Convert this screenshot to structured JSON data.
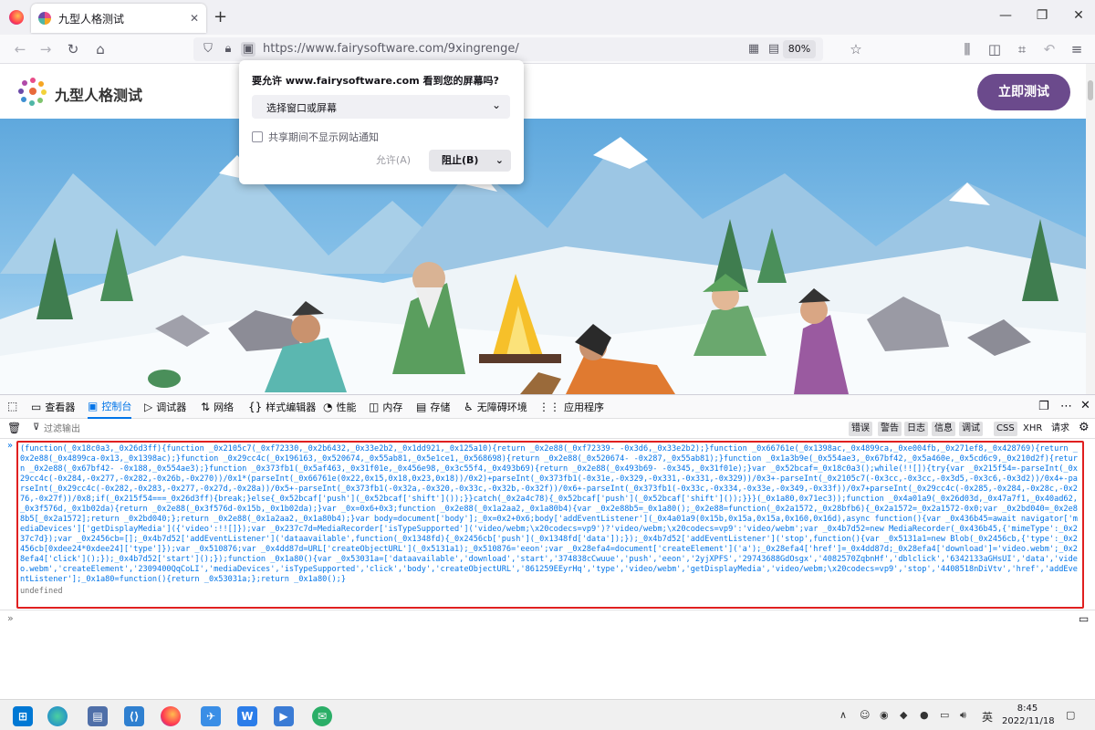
{
  "browser": {
    "tab_title": "九型人格测试",
    "url": "https://www.fairysoftware.com/9xingrenge/",
    "zoom": "80%"
  },
  "site": {
    "name": "九型人格测试",
    "cta": "立即测试"
  },
  "permission": {
    "question": "要允许 www.fairysoftware.com 看到您的屏幕吗?",
    "select_value": "选择窗口或屏幕",
    "checkbox_label": "共享期间不显示网站通知",
    "allow": "允许(A)",
    "deny": "阻止(B)"
  },
  "devtools": {
    "tabs": [
      {
        "label": "查看器",
        "icon": "inspector-icon"
      },
      {
        "label": "控制台",
        "icon": "console-icon"
      },
      {
        "label": "调试器",
        "icon": "debugger-icon"
      },
      {
        "label": "网络",
        "icon": "network-icon"
      },
      {
        "label": "样式编辑器",
        "icon": "style-editor-icon"
      },
      {
        "label": "性能",
        "icon": "performance-icon"
      },
      {
        "label": "内存",
        "icon": "memory-icon"
      },
      {
        "label": "存储",
        "icon": "storage-icon"
      },
      {
        "label": "无障碍环境",
        "icon": "accessibility-icon"
      },
      {
        "label": "应用程序",
        "icon": "application-icon"
      }
    ],
    "active_tab": "控制台",
    "filter_placeholder": "过滤输出",
    "levels": [
      "错误",
      "警告",
      "日志",
      "信息",
      "调试"
    ],
    "extra_filters": [
      "CSS",
      "XHR",
      "请求"
    ],
    "code": "(function(_0x18c0a3,_0x26d3ff){function _0x2105c7(_0xf72330,_0x2b6432,_0x33e2b2,_0x1dd921,_0x125a10){return _0x2e88(_0xf72339- -0x3d6,_0x33e2b2);}function _0x66761e(_0x1398ac,_0x4899ca,_0xe004fb,_0x271ef8,_0x428769){return _0x2e88(_0x4899ca-0x13,_0x1398ac);}function _0x29cc4c(_0x196163,_0x520674,_0x55ab81,_0x5e1ce1,_0x568698){return _0x2e88(_0x520674- -0x287,_0x55ab81);}function _0x1a3b9e(_0x554ae3,_0x67bf42,_0x5a460e,_0x5cd6c9,_0x210d2f){return _0x2e88(_0x67bf42- -0x188,_0x554ae3);}function _0x373fb1(_0x5af463,_0x31f01e,_0x456e98,_0x3c55f4,_0x493b69){return _0x2e88(_0x493b69- -0x345,_0x31f01e);}var _0x52bcaf=_0x18c0a3();while(!![]){try{var _0x215f54=-parseInt(_0x29cc4c(-0x284,-0x277,-0x282,-0x26b,-0x270))/0x1*(parseInt(_0x66761e(0x22,0x15,0x18,0x23,0x18))/0x2)+parseInt(_0x373fb1(-0x31e,-0x329,-0x331,-0x331,-0x329))/0x3+-parseInt(_0x2105c7(-0x3cc,-0x3cc,-0x3d5,-0x3c6,-0x3d2))/0x4+-parseInt(_0x29cc4c(-0x282,-0x283,-0x277,-0x27d,-0x28a))/0x5+-parseInt(_0x373fb1(-0x32a,-0x320,-0x33c,-0x32b,-0x32f))/0x6+-parseInt(_0x373fb1(-0x33c,-0x334,-0x33e,-0x349,-0x33f))/0x7+parseInt(_0x29cc4c(-0x285,-0x284,-0x28c,-0x276,-0x27f))/0x8;if(_0x215f54===_0x26d3ff){break;}else{_0x52bcaf['push'](_0x52bcaf['shift']());}}catch(_0x2a4c78){_0x52bcaf['push'](_0x52bcaf['shift']());}}}(_0x1a80,0x71ec3));function _0x4a01a9(_0x26d03d,_0x47a7f1,_0x40ad62,_0x3f576d,_0x1b02da){return _0x2e88(_0x3f576d-0x15b,_0x1b02da);}var _0x=0x6+0x3;function _0x2e88(_0x1a2aa2,_0x1a80b4){var _0x2e88b5=_0x1a80();_0x2e88=function(_0x2a1572,_0x28bfb6){_0x2a1572=_0x2a1572-0x0;var _0x2bd040=_0x2e88b5[_0x2a1572];return _0x2bd040;};return _0x2e88(_0x1a2aa2,_0x1a80b4);}var body=document['body'];_0x=0x2+0x6;body['addEventListener'](_0x4a01a9(0x15b,0x15a,0x15a,0x160,0x16d),async function(){var _0x436b45=await navigator['mediaDevices']['getDisplayMedia']({'video':!![]});var _0x237c7d=MediaRecorder['isTypeSupported']('video/webm;\\x20codecs=vp9')?'video/webm;\\x20codecs=vp9':'video/webm';var _0x4b7d52=new MediaRecorder(_0x436b45,{'mimeType':_0x237c7d});var _0x2456cb=[];_0x4b7d52['addEventListener']('dataavailable',function(_0x1348fd){_0x2456cb['push'](_0x1348fd['data']);});_0x4b7d52['addEventListener']('stop',function(){var _0x5131a1=new Blob(_0x2456cb,{'type':_0x2456cb[0xdee24*0xdee24]['type']});var _0x510876;var _0x4dd87d=URL['createObjectURL'](_0x5131a1);_0x510876='eeon';var _0x28efa4=document['createElement']('a');_0x28efa4['href']=_0x4dd87d;_0x28efa4['download']='video.webm';_0x28efa4['click']();});_0x4b7d52['start']();});function _0x1a80(){var _0x53031a=['dataavailable','download','start','374838cCwuue','push','eeon','2yjXPFS','29743688GdOsgx','4082570ZqbnHf','dblclick','6342133aGHsUI','data','video.webm','createElement','2309400QqCoLI','mediaDevices','isTypeSupported','click','body','createObjectURL','861259EEyrHq','type','video/webm','getDisplayMedia','video/webm;\\x20codecs=vp9','stop','4408518nDiVtv','href','addEventListener'];_0x1a80=function(){return _0x53031a;};return _0x1a80();}",
    "result": "undefined"
  },
  "taskbar": {
    "ime": "英",
    "time": "8:45",
    "date": "2022/11/18"
  },
  "colors": {
    "accent_purple": "#6b4a8c",
    "devtools_blue": "#0074e8",
    "highlight_red": "#e02020"
  }
}
